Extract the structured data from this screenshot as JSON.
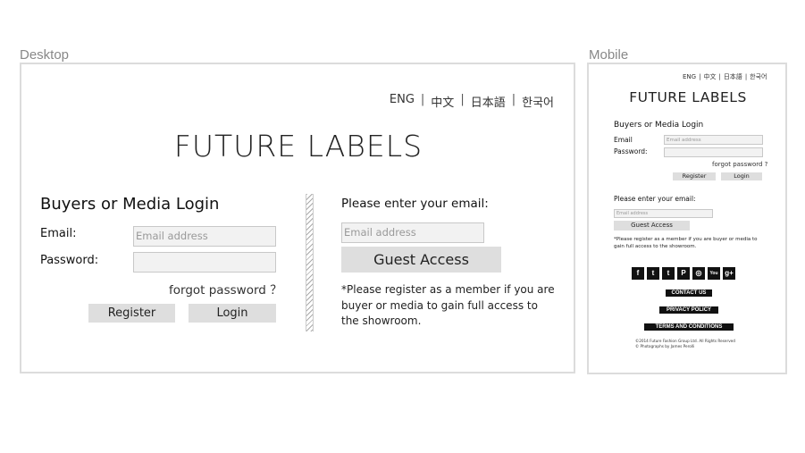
{
  "labels": {
    "desktop": "Desktop",
    "mobile": "Mobile"
  },
  "languages": [
    "ENG",
    "中文",
    "日本語",
    "한국어"
  ],
  "brand": "FUTURE LABELS",
  "login": {
    "title": "Buyers or Media Login",
    "email_label": "Email:",
    "email_placeholder": "Email address",
    "password_label": "Password:",
    "forgot": "forgot password ？",
    "register": "Register",
    "login": "Login"
  },
  "guest": {
    "prompt": "Please enter your email:",
    "email_placeholder": "Email address",
    "button": "Guest Access",
    "note": "*Please register as a member if you are buyer or media to gain full access to the showroom."
  },
  "mobile": {
    "email_label": "Email",
    "password_label": "Password:",
    "forgot": "forgot password ?",
    "social_icons": [
      "facebook-icon",
      "twitter-icon",
      "tumblr-icon",
      "pinterest-icon",
      "instagram-icon",
      "youtube-icon",
      "google-plus-icon"
    ],
    "social_glyphs": [
      "f",
      "t",
      "t",
      "P",
      "◎",
      "You",
      "g+"
    ],
    "links": [
      "CONTACT US",
      "PRIVACY POLICY",
      "TERMS AND CONDITIONS"
    ],
    "copyright": "©2014 Future Fashion Group Ltd. All Rights Reserved",
    "credit": "© Photographs by James Perolli"
  }
}
